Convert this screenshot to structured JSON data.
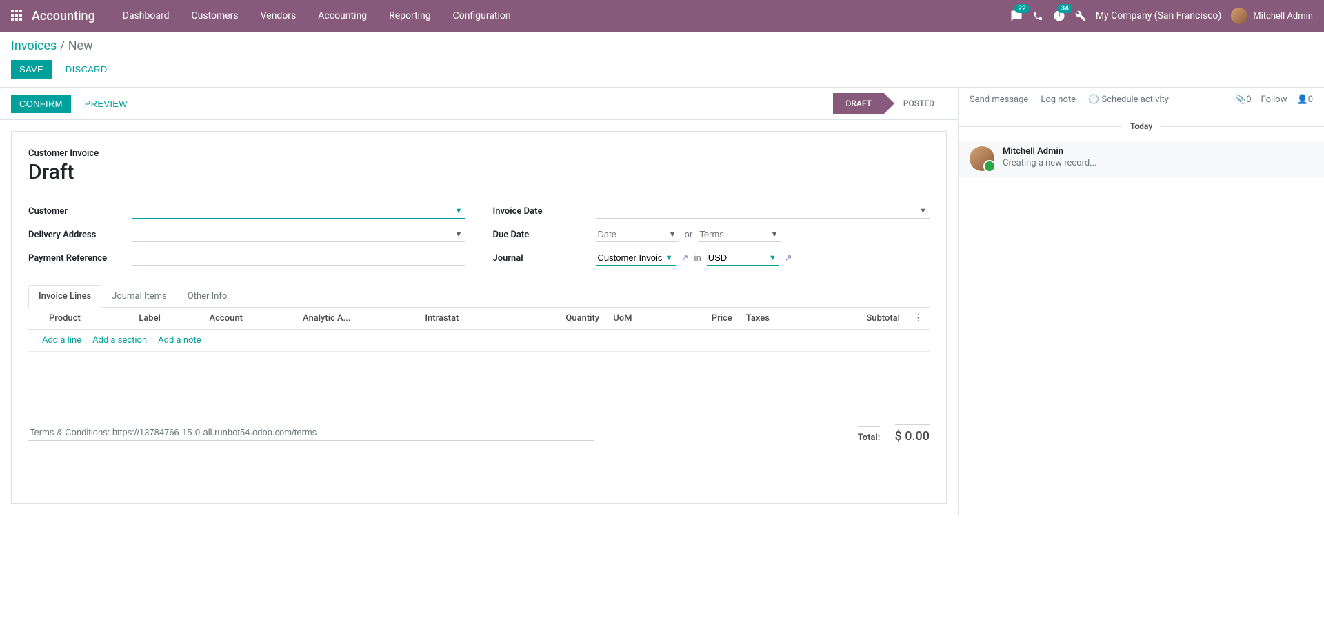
{
  "nav": {
    "brand": "Accounting",
    "items": [
      "Dashboard",
      "Customers",
      "Vendors",
      "Accounting",
      "Reporting",
      "Configuration"
    ],
    "messages_badge": "22",
    "activities_badge": "34",
    "company": "My Company (San Francisco)",
    "user": "Mitchell Admin"
  },
  "breadcrumb": {
    "root": "Invoices",
    "current": "New"
  },
  "actions": {
    "save": "Save",
    "discard": "Discard"
  },
  "statusbar": {
    "confirm": "Confirm",
    "preview": "Preview",
    "draft": "Draft",
    "posted": "Posted"
  },
  "form": {
    "subtitle": "Customer Invoice",
    "title": "Draft",
    "labels": {
      "customer": "Customer",
      "delivery_address": "Delivery Address",
      "payment_reference": "Payment Reference",
      "invoice_date": "Invoice Date",
      "due_date": "Due Date",
      "journal": "Journal"
    },
    "due_date": {
      "date_placeholder": "Date",
      "or": "or",
      "terms_placeholder": "Terms"
    },
    "journal": {
      "value": "Customer Invoice",
      "in": "in",
      "currency": "USD"
    }
  },
  "tabs": {
    "invoice_lines": "Invoice Lines",
    "journal_items": "Journal Items",
    "other_info": "Other Info"
  },
  "table": {
    "headers": [
      "Product",
      "Label",
      "Account",
      "Analytic A...",
      "Intrastat",
      "Quantity",
      "UoM",
      "Price",
      "Taxes",
      "Subtotal"
    ],
    "add_line": "Add a line",
    "add_section": "Add a section",
    "add_note": "Add a note"
  },
  "footer": {
    "terms": "Terms & Conditions: https://13784766-15-0-all.runbot54.odoo.com/terms",
    "total_label": "Total:",
    "total_amount": "$ 0.00"
  },
  "chatter": {
    "send_message": "Send message",
    "log_note": "Log note",
    "schedule_activity": "Schedule activity",
    "attachments": "0",
    "follow": "Follow",
    "followers": "0",
    "separator": "Today",
    "msg_author": "Mitchell Admin",
    "msg_text": "Creating a new record..."
  }
}
